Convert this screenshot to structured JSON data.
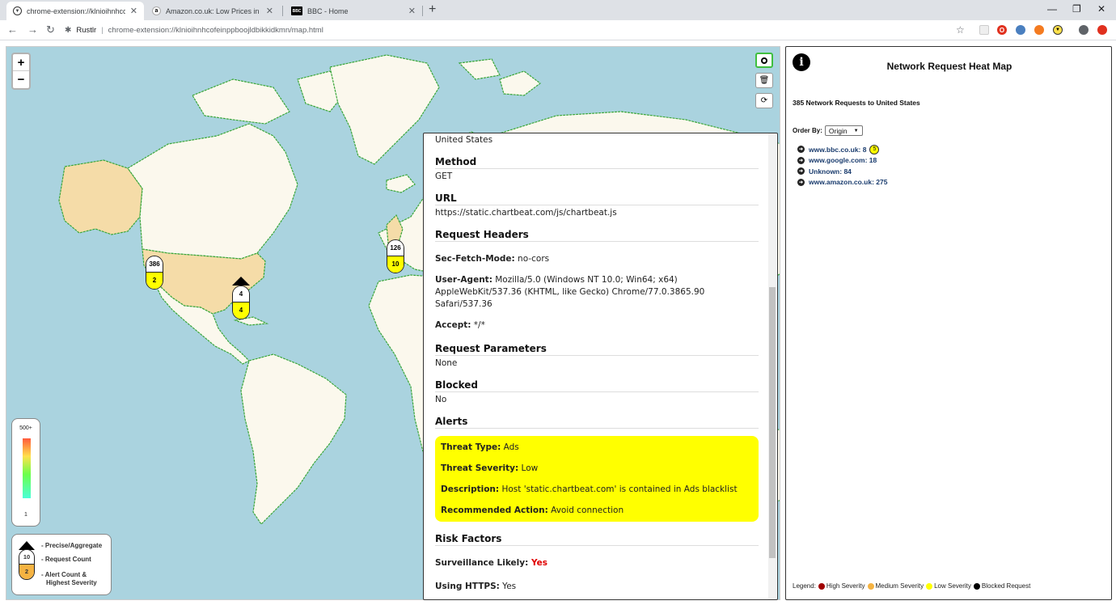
{
  "browser": {
    "tabs": [
      {
        "title": "chrome-extension://klnioihnhcof",
        "icon": "shield-icon",
        "active": true
      },
      {
        "title": "Amazon.co.uk: Low Prices in Elec",
        "icon": "amazon-icon",
        "active": false
      },
      {
        "title": "BBC - Home",
        "icon": "bbc-icon",
        "active": false
      }
    ],
    "omnibox": {
      "ext_name": "Rustlr",
      "url": "chrome-extension://klnioihnhcofeinppboojldbikkidkmn/map.html"
    },
    "icons": [
      "back-icon",
      "forward-icon",
      "reload-icon",
      "bookmark-star-icon",
      "profile-icon",
      "menu-icon"
    ]
  },
  "map": {
    "zoom_in": "+",
    "zoom_out": "−",
    "markers": [
      {
        "count": "386",
        "alerts": "2"
      },
      {
        "count": "4",
        "alerts": "4"
      },
      {
        "count": "126",
        "alerts": "10"
      }
    ],
    "scale": {
      "max": "500+",
      "min": "1"
    },
    "legend": {
      "sample_count": "10",
      "sample_alerts": "2",
      "precise": "- Precise/Aggregate",
      "count": "- Request Count",
      "alert_line1": "- Alert Count &",
      "alert_line2": "Highest Severity"
    }
  },
  "details": {
    "country": "United States",
    "method_label": "Method",
    "method": "GET",
    "url_label": "URL",
    "url": "https://static.chartbeat.com/js/chartbeat.js",
    "headers_label": "Request Headers",
    "headers": [
      {
        "key": "Sec-Fetch-Mode:",
        "value": " no-cors"
      },
      {
        "key": "User-Agent:",
        "value": " Mozilla/5.0 (Windows NT 10.0; Win64; x64) AppleWebKit/537.36 (KHTML, like Gecko) Chrome/77.0.3865.90 Safari/537.36"
      },
      {
        "key": "Accept:",
        "value": " */*"
      }
    ],
    "params_label": "Request Parameters",
    "params": "None",
    "blocked_label": "Blocked",
    "blocked": "No",
    "alerts_label": "Alerts",
    "alerts": [
      {
        "key": "Threat Type:",
        "value": " Ads"
      },
      {
        "key": "Threat Severity:",
        "value": " Low"
      },
      {
        "key": "Description:",
        "value": " Host 'static.chartbeat.com' is contained in Ads blacklist"
      },
      {
        "key": "Recommended Action:",
        "value": " Avoid connection"
      }
    ],
    "risk_label": "Risk Factors",
    "risk": [
      {
        "key": "Surveillance Likely:",
        "value": " Yes"
      },
      {
        "key": "Using HTTPS:",
        "value": " Yes"
      }
    ]
  },
  "panel": {
    "title": "Network Request Heat Map",
    "subtitle": "385 Network Requests to United States",
    "order_label": "Order By:",
    "order_value": "Origin",
    "origins": [
      {
        "label": "www.bbc.co.uk: 8",
        "badge": "5"
      },
      {
        "label": "www.google.com: 18"
      },
      {
        "label": "Unknown: 84"
      },
      {
        "label": "www.amazon.co.uk: 275"
      }
    ],
    "legend": {
      "label": "Legend:",
      "high": "High Severity",
      "medium": "Medium Severity",
      "low": "Low Severity",
      "blocked": "Blocked Request"
    },
    "colors": {
      "high": "#a00000",
      "medium": "#f5b342",
      "low": "#ffff00",
      "blocked": "#000000"
    }
  }
}
